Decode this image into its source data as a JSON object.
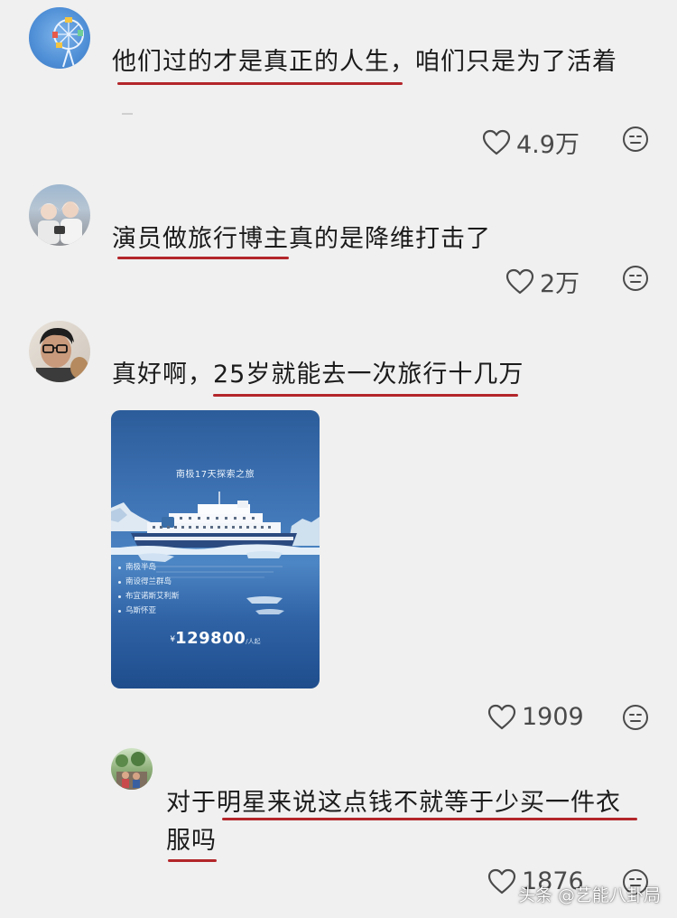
{
  "comments": [
    {
      "text": "他们过的才是真正的人生，咱们只是为了活着",
      "likes": "4.9万"
    },
    {
      "text": "演员做旅行博主真的是降维打击了",
      "likes": "2万"
    },
    {
      "text": "真好啊，25岁就能去一次旅行十几万",
      "likes": "1909",
      "attachment": {
        "title": "南极17天探索之旅",
        "route": [
          "南极半岛",
          "南设得兰群岛",
          "布宜诺斯艾利斯",
          "乌斯怀亚"
        ],
        "currency_symbol": "¥",
        "price": "129800",
        "price_unit": "/人起"
      }
    },
    {
      "text_line1": "对于明星来说这点钱不就等于少买一件衣",
      "text_line2": "服吗",
      "likes": "1876"
    }
  ],
  "icons": {
    "like": "heart-outline-icon",
    "react": "neutral-face-icon"
  },
  "colors": {
    "underline": "#b3262a",
    "background": "#f0f0f0"
  },
  "watermark": "头条 @艺能八卦局"
}
